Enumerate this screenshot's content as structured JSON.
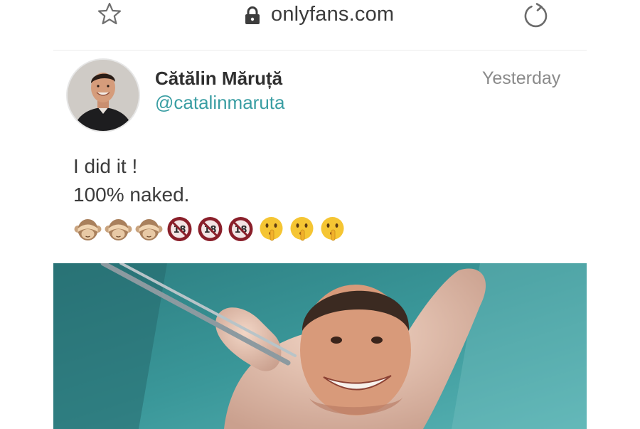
{
  "browser": {
    "url": "onlyfans.com",
    "icons": [
      "star-icon",
      "lock-icon",
      "reload-icon"
    ]
  },
  "post": {
    "author": {
      "name": "Cătălin Măruță",
      "handle": "@catalinmaruta"
    },
    "time": "Yesterday",
    "text_lines": [
      "I did it !",
      "100% naked."
    ],
    "emojis": [
      "see-no-evil-monkey",
      "see-no-evil-monkey",
      "see-no-evil-monkey",
      "no-one-under-18",
      "no-one-under-18",
      "no-one-under-18",
      "shushing-face",
      "shushing-face",
      "shushing-face"
    ]
  },
  "colors": {
    "handle": "#3a9ea3",
    "name": "#2f2f2f",
    "time": "#8a8a8a",
    "text": "#3b3b3b",
    "photo_background": "#2f8487"
  }
}
